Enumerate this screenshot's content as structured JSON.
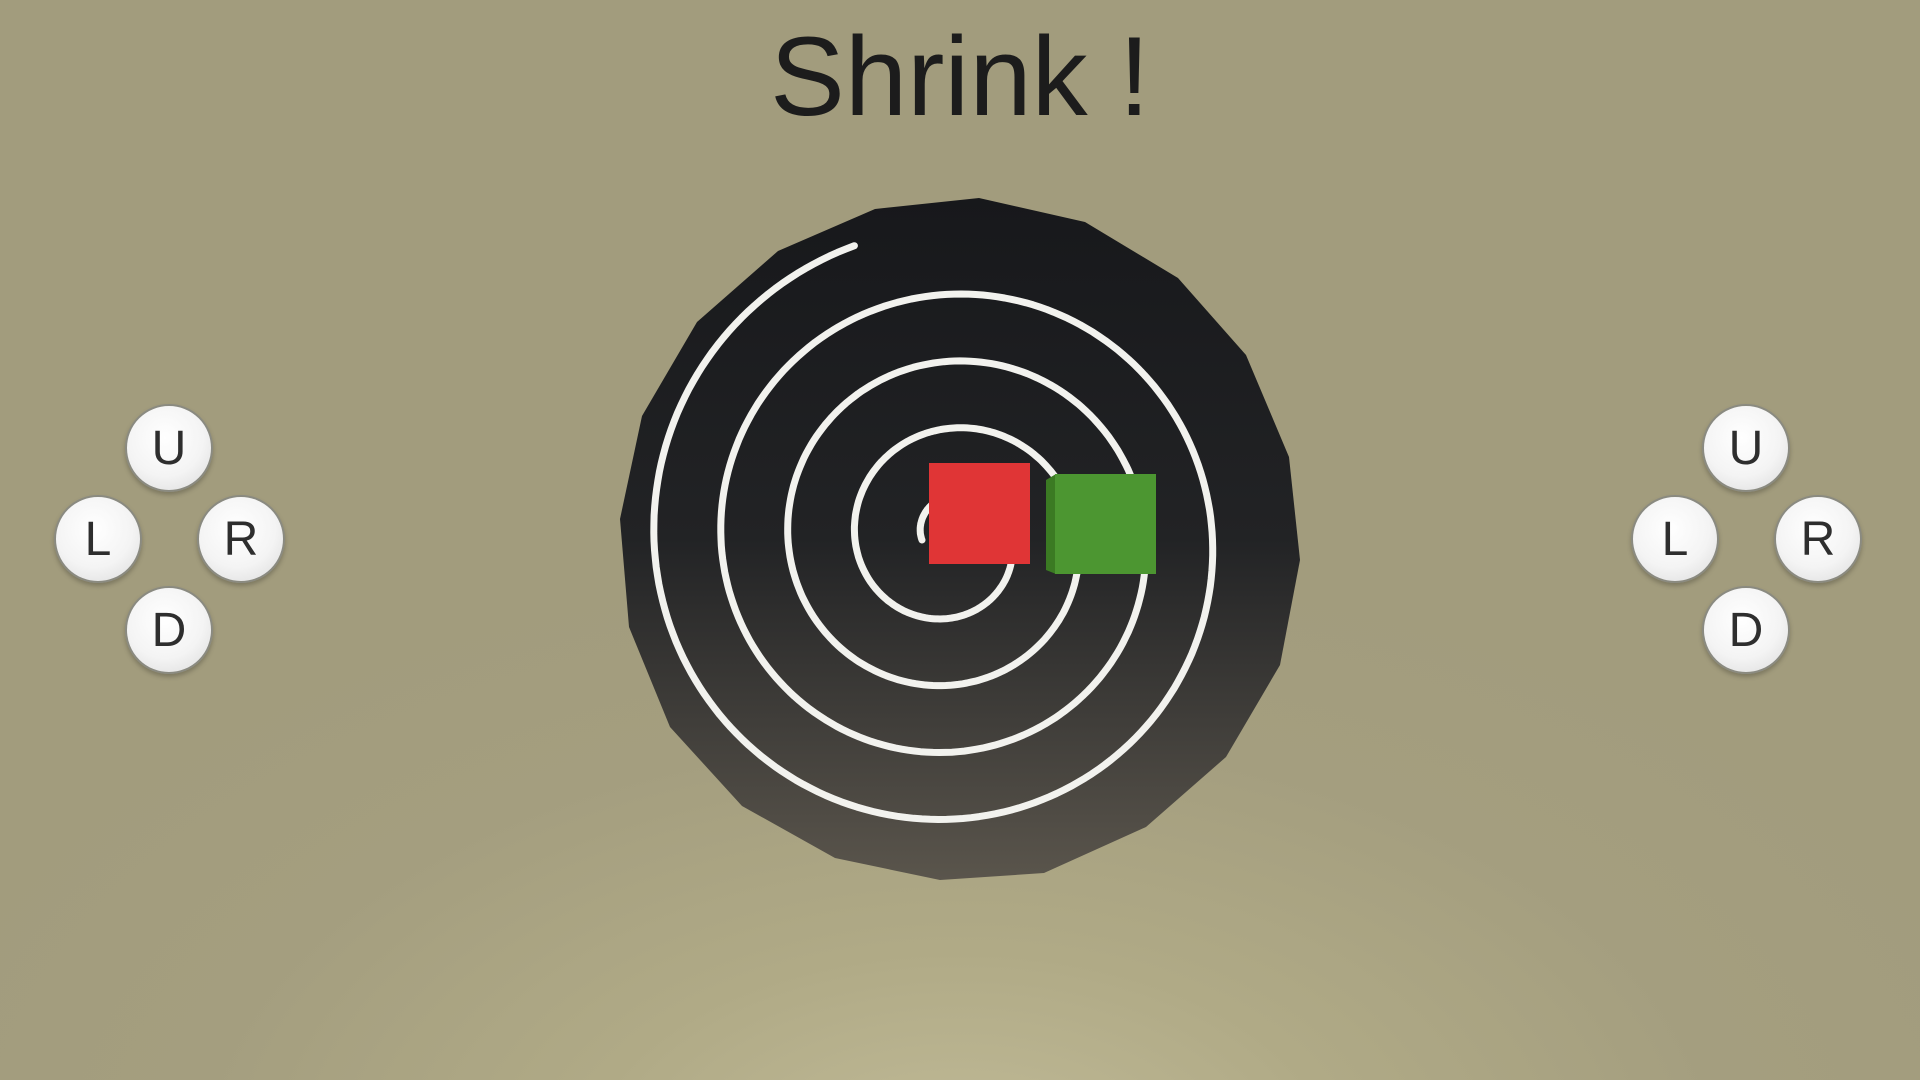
{
  "title": "Shrink !",
  "controls": {
    "left_pad": {
      "up": "U",
      "left": "L",
      "right": "R",
      "down": "D"
    },
    "right_pad": {
      "up": "U",
      "left": "L",
      "right": "R",
      "down": "D"
    }
  },
  "pieces": {
    "red_block_color": "#e03536",
    "green_block_color": "#4c9631"
  },
  "colors": {
    "board": "#1f2023",
    "spiral_track": "#f2f2ee",
    "background": "#a49e7f"
  }
}
